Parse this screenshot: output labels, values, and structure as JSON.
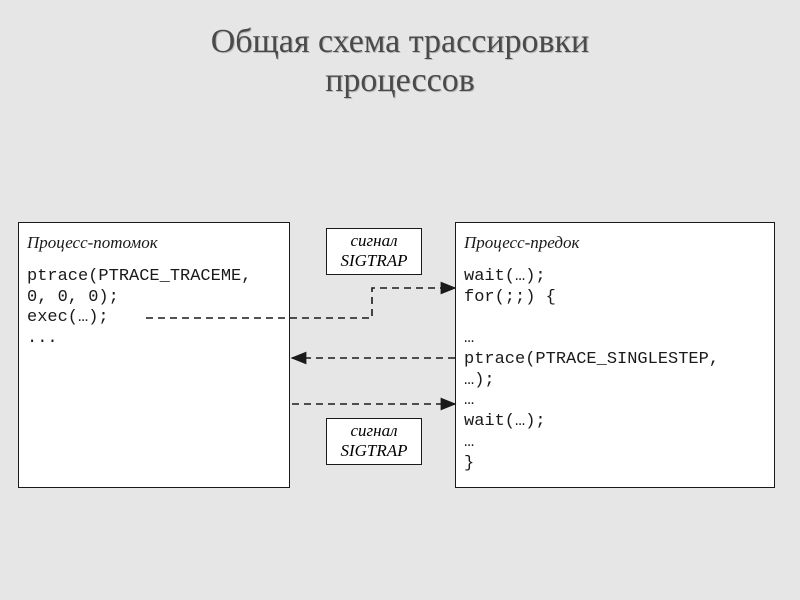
{
  "title_line1": "Общая схема трассировки",
  "title_line2": "процессов",
  "left_box": {
    "title": "Процесс-потомок",
    "code": "ptrace(PTRACE_TRACEME,\n0, 0, 0);\nexec(…);\n..."
  },
  "right_box": {
    "title": "Процесс-предок",
    "code": "wait(…);\nfor(;;) {\n\n…\nptrace(PTRACE_SINGLESTEP,\n…);\n…\nwait(…);\n…\n}"
  },
  "signal_top": "сигнал\nSIGTRAP",
  "signal_bot": "сигнал\nSIGTRAP",
  "arrows": [
    {
      "from": "exec-call",
      "to": "wait-call",
      "kind": "right-then-up"
    },
    {
      "from": "ptrace-singlestep",
      "to": "child-process",
      "kind": "left"
    },
    {
      "from": "child-process",
      "to": "wait-loop",
      "kind": "right"
    }
  ]
}
